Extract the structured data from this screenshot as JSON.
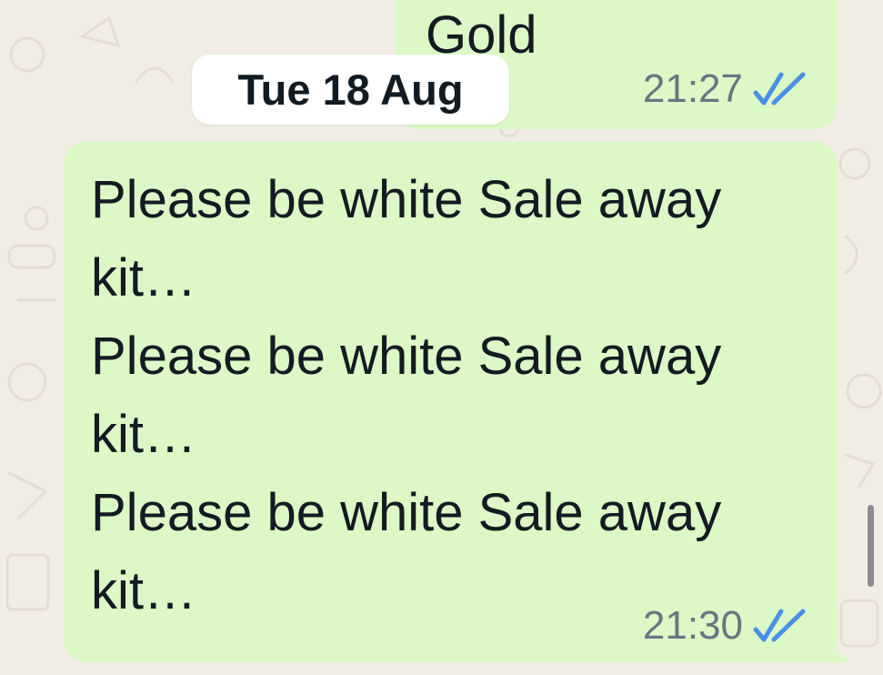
{
  "date_separator": "Tue 18 Aug",
  "messages": [
    {
      "id": "top",
      "text": "Gold",
      "time": "21:27",
      "status_icon": "double-check-read-icon"
    },
    {
      "id": "main",
      "lines": [
        "Please be white Sale away",
        "kit…",
        "Please be white Sale away",
        "kit…",
        "Please be white Sale away",
        "kit…"
      ],
      "time": "21:30",
      "status_icon": "double-check-read-icon"
    }
  ],
  "colors": {
    "outgoing_bubble": "#dcf8c6",
    "background": "#f1ede5",
    "read_ticks": "#4a8fe7",
    "timestamp": "#667781"
  }
}
